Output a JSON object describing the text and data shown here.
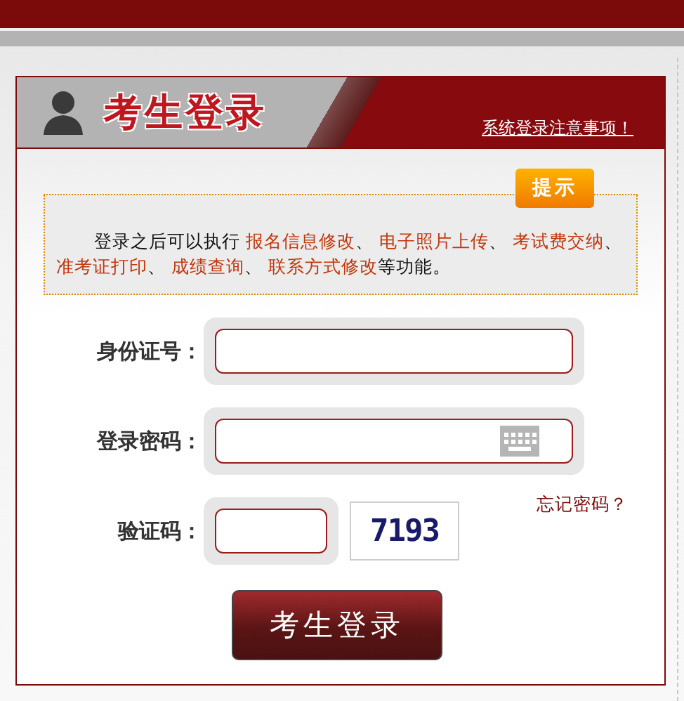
{
  "header": {
    "title": "考生登录",
    "notice_link": "系统登录注意事项！"
  },
  "tip": {
    "badge": "提示",
    "segments": [
      {
        "text": "登录之后可以执行 ",
        "link": false
      },
      {
        "text": "报名信息修改",
        "link": true
      },
      {
        "text": "、 ",
        "link": false
      },
      {
        "text": "电子照片上传",
        "link": true
      },
      {
        "text": "、 ",
        "link": false
      },
      {
        "text": "考试费交纳",
        "link": true
      },
      {
        "text": "、 ",
        "link": false
      },
      {
        "text": "准考证打印",
        "link": true
      },
      {
        "text": "、 ",
        "link": false
      },
      {
        "text": "成绩查询",
        "link": true
      },
      {
        "text": "、 ",
        "link": false
      },
      {
        "text": "联系方式修改",
        "link": true
      },
      {
        "text": "等功能。",
        "link": false
      }
    ]
  },
  "fields": [
    {
      "kind": "id",
      "label": "身份证号："
    },
    {
      "kind": "password",
      "label": "登录密码："
    },
    {
      "kind": "captcha",
      "label": "验证码：",
      "captcha": "7193"
    }
  ],
  "forgot_link": "忘记密码？",
  "login_button": "考生登录"
}
